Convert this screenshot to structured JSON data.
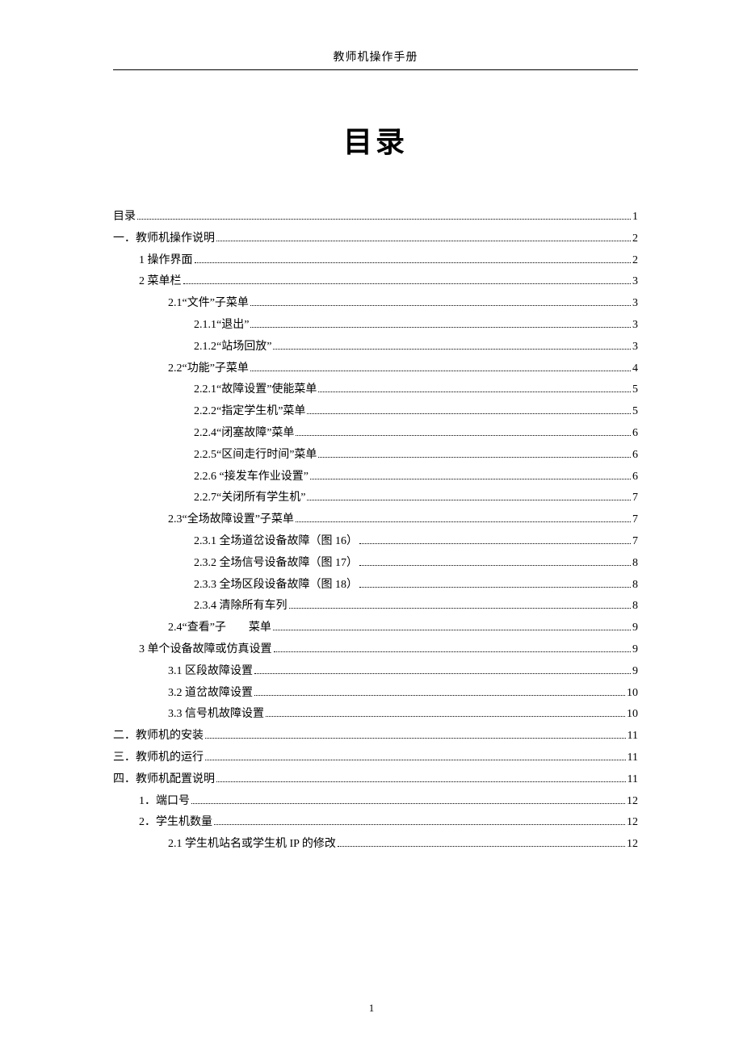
{
  "header": "教师机操作手册",
  "title": "目录",
  "footer_page": "1",
  "toc": [
    {
      "indent": 0,
      "label": "目录",
      "page": "1"
    },
    {
      "indent": 0,
      "label": "一．教师机操作说明",
      "page": "2"
    },
    {
      "indent": 1,
      "label": "1 操作界面",
      "page": "2"
    },
    {
      "indent": 1,
      "label": "2 菜单栏",
      "page": "3"
    },
    {
      "indent": 2,
      "label": "2.1“文件”子菜单",
      "page": "3"
    },
    {
      "indent": 3,
      "label": "2.1.1“退出”",
      "page": "3"
    },
    {
      "indent": 3,
      "label": "2.1.2“站场回放”",
      "page": "3"
    },
    {
      "indent": 2,
      "label": "2.2“功能”子菜单",
      "page": "4"
    },
    {
      "indent": 3,
      "label": "2.2.1“故障设置”使能菜单",
      "page": "5"
    },
    {
      "indent": 3,
      "label": "2.2.2“指定学生机”菜单",
      "page": "5"
    },
    {
      "indent": 3,
      "label": "2.2.4“闭塞故障”菜单",
      "page": "6"
    },
    {
      "indent": 3,
      "label": "2.2.5“区间走行时间”菜单",
      "page": "6"
    },
    {
      "indent": 3,
      "label": "2.2.6 “接发车作业设置”",
      "page": "6"
    },
    {
      "indent": 3,
      "label": "2.2.7“关闭所有学生机”",
      "page": "7"
    },
    {
      "indent": 2,
      "label": "2.3“全场故障设置”子菜单",
      "page": "7"
    },
    {
      "indent": 3,
      "label": "2.3.1 全场道岔设备故障（图 16）",
      "page": "7"
    },
    {
      "indent": 3,
      "label": "2.3.2 全场信号设备故障（图 17）",
      "page": "8"
    },
    {
      "indent": 3,
      "label": "2.3.3 全场区段设备故障（图 18）",
      "page": "8"
    },
    {
      "indent": 3,
      "label": "2.3.4 清除所有车列",
      "page": "8"
    },
    {
      "indent": 2,
      "label": "2.4“查看”子　　菜单",
      "page": "9"
    },
    {
      "indent": 1,
      "label": "3 单个设备故障或仿真设置",
      "page": "9"
    },
    {
      "indent": 2,
      "label": "3.1 区段故障设置",
      "page": "9"
    },
    {
      "indent": 2,
      "label": "3.2 道岔故障设置",
      "page": "10"
    },
    {
      "indent": 2,
      "label": "3.3 信号机故障设置",
      "page": "10"
    },
    {
      "indent": 0,
      "label": "二．教师机的安装",
      "page": "11"
    },
    {
      "indent": 0,
      "label": "三．教师机的运行",
      "page": "11"
    },
    {
      "indent": 0,
      "label": "四．教师机配置说明",
      "page": "11"
    },
    {
      "indent": 1,
      "label": "1．端口号",
      "page": "12"
    },
    {
      "indent": 1,
      "label": "2．学生机数量",
      "page": "12"
    },
    {
      "indent": 2,
      "label": "2.1  学生机站名或学生机 IP 的修改",
      "page": "12"
    }
  ]
}
